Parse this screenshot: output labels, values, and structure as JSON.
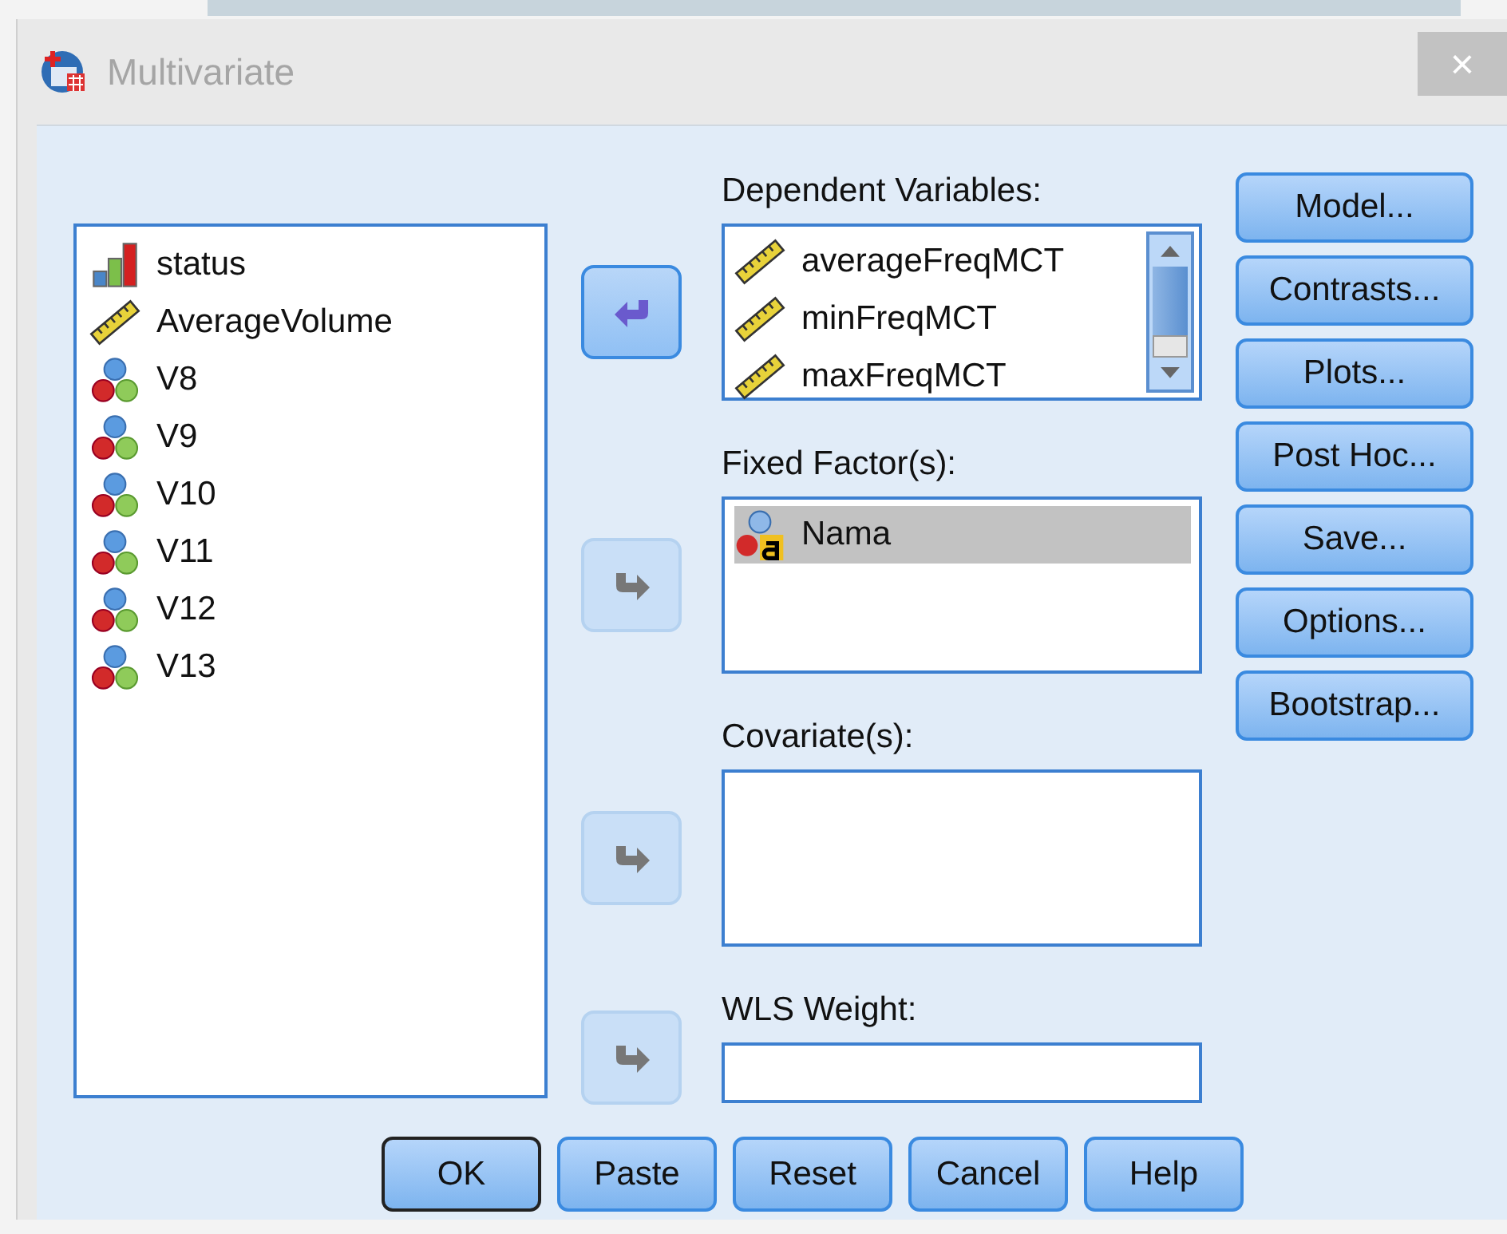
{
  "window": {
    "title": "Multivariate",
    "close": "×"
  },
  "source_list": {
    "items": [
      {
        "name": "status",
        "kind": "ordinal",
        "selected": false
      },
      {
        "name": "AverageVolume",
        "kind": "scale",
        "selected": false
      },
      {
        "name": "V8",
        "kind": "nominal",
        "selected": false
      },
      {
        "name": "V9",
        "kind": "nominal",
        "selected": false
      },
      {
        "name": "V10",
        "kind": "nominal",
        "selected": false
      },
      {
        "name": "V11",
        "kind": "nominal",
        "selected": false
      },
      {
        "name": "V12",
        "kind": "nominal",
        "selected": false
      },
      {
        "name": "V13",
        "kind": "nominal",
        "selected": false
      }
    ]
  },
  "targets": [
    {
      "label": "Dependent Variables:",
      "kind": "list",
      "arrow": {
        "kind": "remove",
        "disabled": false
      },
      "scrollbar": true,
      "items": [
        {
          "name": "averageFreqMCT",
          "kind": "scale",
          "selected": false
        },
        {
          "name": "minFreqMCT",
          "kind": "scale",
          "selected": false
        },
        {
          "name": "maxFreqMCT",
          "kind": "scale",
          "selected": false
        }
      ]
    },
    {
      "label": "Fixed Factor(s):",
      "kind": "list",
      "arrow": {
        "kind": "add",
        "disabled": true
      },
      "scrollbar": false,
      "items": [
        {
          "name": "Nama",
          "kind": "nominal-string",
          "selected": true
        }
      ]
    },
    {
      "label": "Covariate(s):",
      "kind": "list",
      "arrow": {
        "kind": "add",
        "disabled": true
      },
      "scrollbar": false
    },
    {
      "label": "WLS Weight:",
      "kind": "field",
      "arrow": {
        "kind": "add",
        "disabled": true
      }
    }
  ],
  "side_buttons": [
    {
      "label": "Model..."
    },
    {
      "label": "Contrasts..."
    },
    {
      "label": "Plots..."
    },
    {
      "label": "Post Hoc..."
    },
    {
      "label": "Save..."
    },
    {
      "label": "Options..."
    },
    {
      "label": "Bootstrap..."
    }
  ],
  "bottom_buttons": [
    {
      "label": "OK",
      "default": true
    },
    {
      "label": "Paste",
      "default": false
    },
    {
      "label": "Reset",
      "default": false
    },
    {
      "label": "Cancel",
      "default": false
    },
    {
      "label": "Help",
      "default": false
    }
  ]
}
